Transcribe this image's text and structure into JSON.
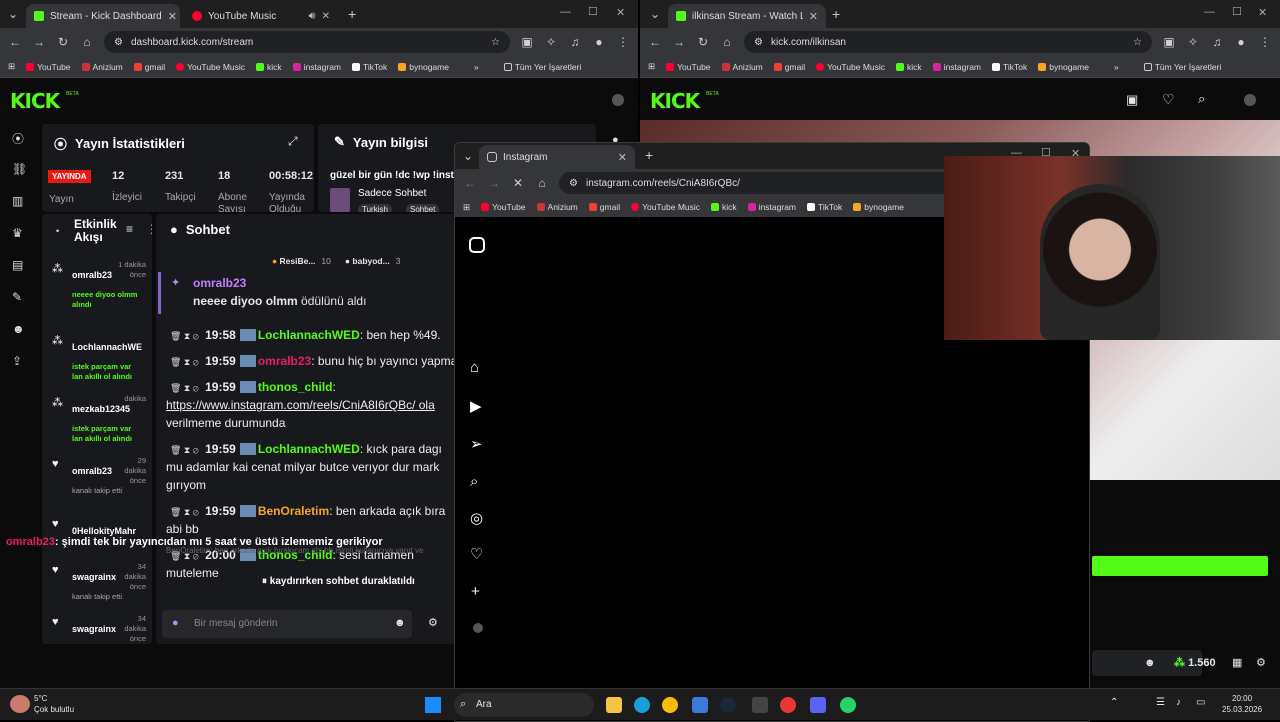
{
  "left_browser": {
    "tabs": [
      {
        "title": "Stream - Kick Dashboard",
        "active": true
      },
      {
        "title": "YouTube Music",
        "active": false
      }
    ],
    "url": "dashboard.kick.com/stream",
    "bookmarks": [
      "YouTube",
      "Anizium",
      "gmail",
      "YouTube Music",
      "kick",
      "instagram",
      "TikTok",
      "bynogame"
    ],
    "bookmarks_all": "Tüm Yer İşaretleri"
  },
  "right_browser": {
    "tabs": [
      {
        "title": "ilkinsan Stream - Watch Live on",
        "active": true
      }
    ],
    "url": "kick.com/ilkinsan",
    "bookmarks": [
      "YouTube",
      "Anizium",
      "gmail",
      "YouTube Music",
      "kick",
      "instagram",
      "TikTok",
      "bynogame"
    ],
    "bookmarks_all": "Tüm Yer İşaretleri",
    "follower_count": "1.560"
  },
  "popup_browser": {
    "tab_title": "Instagram",
    "url": "instagram.com/reels/CniA8I6rQBc/",
    "bookmarks": [
      "YouTube",
      "Anizium",
      "gmail",
      "YouTube Music",
      "kick",
      "instagram",
      "TikTok",
      "bynogame"
    ]
  },
  "dashboard": {
    "logo": "KICK",
    "beta": "BETA",
    "stats_title": "Yayın İstatistikleri",
    "live_badge": "YAYINDA",
    "live_label": "Yayın",
    "viewers_value": "12",
    "viewers_label": "İzleyici",
    "followers_value": "231",
    "followers_label": "Takipçi",
    "subs_value": "18",
    "subs_label": "Abone Sayısı",
    "uptime_value": "00:58:12",
    "uptime_label": "Yayında Olduğu",
    "info_title": "Yayın bilgisi",
    "stream_title": "güzel bir gün !dc !wp !insta",
    "category": "Sadece Sohbet",
    "tags": [
      "Turkish",
      "Sohbet"
    ],
    "activity_title": "Etkinlik Akışı",
    "activity": [
      {
        "user": "omralb23",
        "time": "1 dakika önce",
        "detail": "neeee diyoo olmm alındı"
      },
      {
        "user": "LochlannachWE",
        "time": "",
        "detail": "istek parçam var lan akıllı ol alındı"
      },
      {
        "user": "mezkab12345",
        "time": "dakika",
        "detail": "istek parçam var lan akıllı ol alındı"
      },
      {
        "user": "omralb23",
        "time": "29 dakika önce",
        "detail": "kanalı takip etti"
      },
      {
        "user": "0HellokityMahr",
        "time": "",
        "detail": ""
      },
      {
        "user": "swagrainx",
        "time": "34 dakika önce",
        "detail": "kanalı takip etti"
      },
      {
        "user": "swagrainx",
        "time": "34 dakika önce",
        "detail": ""
      }
    ],
    "chat_title": "Sohbet",
    "pinned_a": "ResiBe...",
    "pinned_a_count": "10",
    "pinned_b": "babyod...",
    "pinned_b_count": "3",
    "reward_user": "omralb23",
    "reward_text": "neeee diyoo olmm",
    "reward_suffix": "ödülünü aldı",
    "messages": [
      {
        "time": "19:58",
        "user": "LochlannachWED",
        "text": ": ben hep %49."
      },
      {
        "time": "19:59",
        "user": "omralb23",
        "text": ": bunu hiç bı yayıncı yapma"
      },
      {
        "time": "19:59",
        "user": "thonos_child",
        "text": ":"
      },
      {
        "time": "",
        "user": "",
        "text": "https://www.instagram.com/reels/CniA8I6rQBc/ ola"
      },
      {
        "time": "",
        "user": "",
        "text": "verilmeme durumunda"
      },
      {
        "time": "19:59",
        "user": "LochlannachWED",
        "text": ": kıck para dagı"
      },
      {
        "time": "",
        "user": "",
        "text": "mu adamlar kai cenat milyar butce verıyor dur mark"
      },
      {
        "time": "",
        "user": "",
        "text": "gırıyom"
      },
      {
        "time": "19:59",
        "user": "BenOraletim",
        "text": ": ben arkada açık bıra"
      },
      {
        "time": "",
        "user": "",
        "text": "abi bb"
      },
      {
        "time": "20:00",
        "user": "thonos_child",
        "text": ": sesi tamamen"
      },
      {
        "time": "",
        "user": "",
        "text": "muteleme"
      }
    ],
    "paused": "kaydırırken sohbet duraklatıldı",
    "placeholder": "Bir mesaj gönderin"
  },
  "overlay": {
    "user": "omralb23",
    "text": ": şimdi tek bir yayıncıdan mı 5 saat ve üstü izlememiz gerikiyor",
    "ghost": "BenOraletim: ben arkada açık bırakıcam abi bb isimli kullanıcıya yanıt ve"
  },
  "taskbar": {
    "temp": "5°C",
    "weather": "Çok bulutlu",
    "search": "Ara",
    "time": "20:00",
    "date": "25.03.2026"
  }
}
